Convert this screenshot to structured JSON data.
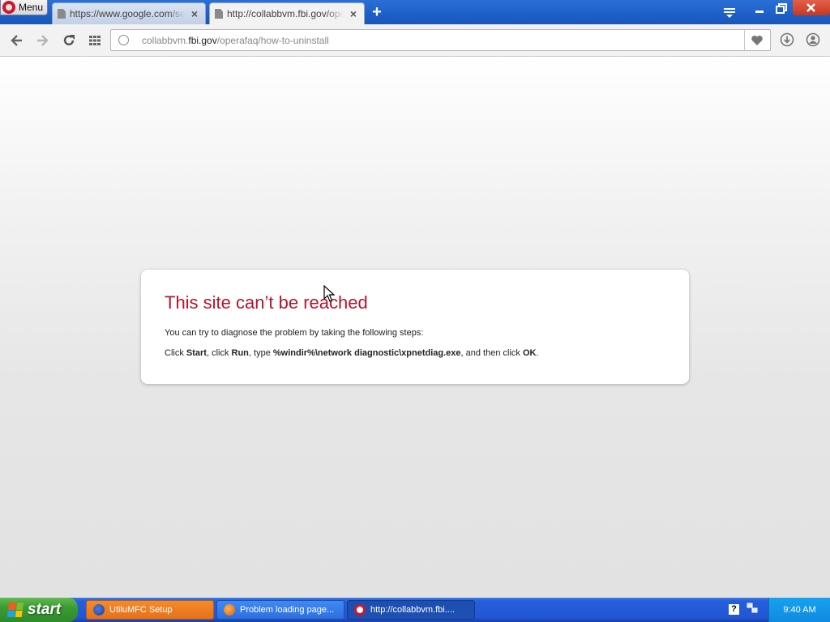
{
  "browser": {
    "menu_label": "Menu",
    "tabs": [
      {
        "title": "https://www.google.com/search?q=opera",
        "active": false
      },
      {
        "title": "http://collabbvm.fbi.gov/operafaq/how-to-uninstall",
        "active": true
      }
    ],
    "new_tab_symbol": "+",
    "address": {
      "prefix": "collabbvm.",
      "domain": "fbi.gov",
      "path": "/operafaq/how-to-uninstall"
    }
  },
  "error_page": {
    "title": "This site can’t be reached",
    "intro": "You can try to diagnose the problem by taking the following steps:",
    "step": {
      "p1": "Click ",
      "b1": "Start",
      "p2": ", click ",
      "b2": "Run",
      "p3": ", type ",
      "b3": "%windir%\\network diagnostic\\xpnetdiag.exe",
      "p4": ", and then click ",
      "b4": "OK",
      "p5": "."
    }
  },
  "taskbar": {
    "start_label": "start",
    "buttons": [
      {
        "label": "UtiluMFC Setup",
        "icon": "firefox-icon"
      },
      {
        "label": "Problem loading page...",
        "icon": "firefox-icon"
      },
      {
        "label": "http://collabbvm.fbi....",
        "icon": "opera-icon"
      }
    ],
    "clock": "9:40 AM"
  },
  "colors": {
    "error_title": "#b8142b",
    "opera_red": "#d3142b",
    "taskbar_blue": "#245edb",
    "start_green": "#3c9b34"
  }
}
